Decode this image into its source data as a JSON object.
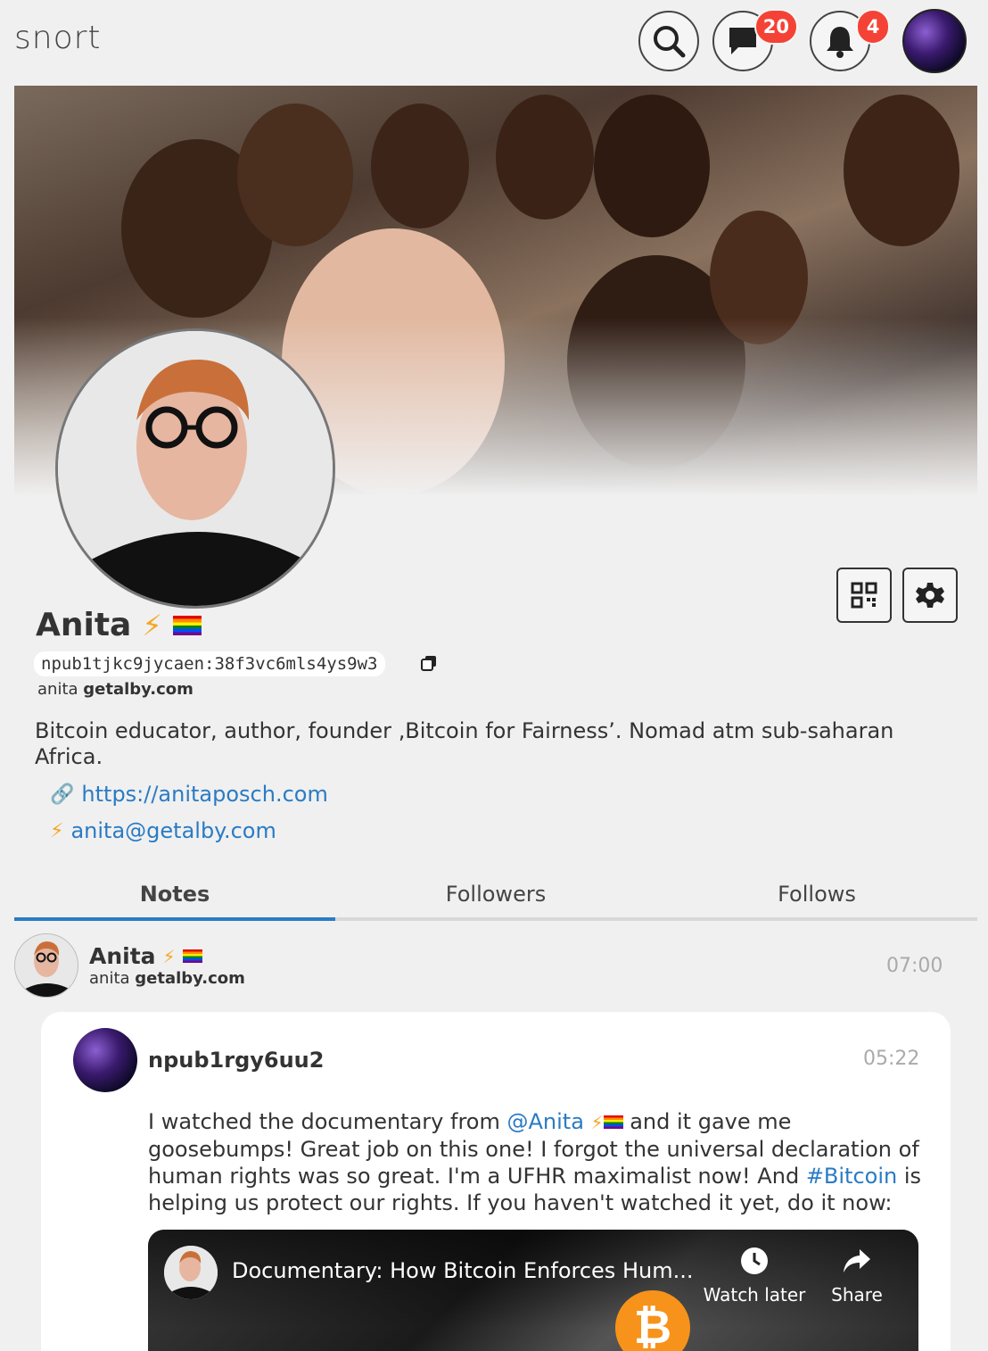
{
  "header": {
    "logo": "snort",
    "messages_badge": "20",
    "notifications_badge": "4"
  },
  "profile": {
    "name": "Anita",
    "npub": "npub1tjkc9jycaen:38f3vc6mls4ys9w3",
    "nip05_user": "anita",
    "nip05_domain": "getalby.com",
    "about": "Bitcoin educator, author, founder ‚Bitcoin for Fairness’. Nomad atm sub-saharan Africa.",
    "website": "https://anitaposch.com",
    "lud16": "anita@getalby.com"
  },
  "tabs": [
    {
      "label": "Notes",
      "active": true
    },
    {
      "label": "Followers",
      "active": false
    },
    {
      "label": "Follows",
      "active": false
    }
  ],
  "note": {
    "author": "Anita",
    "nip05_user": "anita",
    "nip05_domain": "getalby.com",
    "time": "07:00"
  },
  "quoted": {
    "author": "npub1rgy6uu2",
    "time": "05:22",
    "text_1": "I watched the documentary from ",
    "mention": "@Anita",
    "text_2": " and it gave me goosebumps! Great job on this one! I forgot the universal declaration of human rights was so great. I'm a UFHR maximalist now! And ",
    "hashtag": "#Bitcoin",
    "text_3": " is helping us protect our rights. If you haven't watched it yet, do it now:"
  },
  "video": {
    "title": "Documentary: How Bitcoin Enforces Hum...",
    "watch_later": "Watch later",
    "share": "Share"
  },
  "colors": {
    "accent": "#2a7bc4",
    "badge": "#f44336",
    "zap": "#f5a623"
  }
}
